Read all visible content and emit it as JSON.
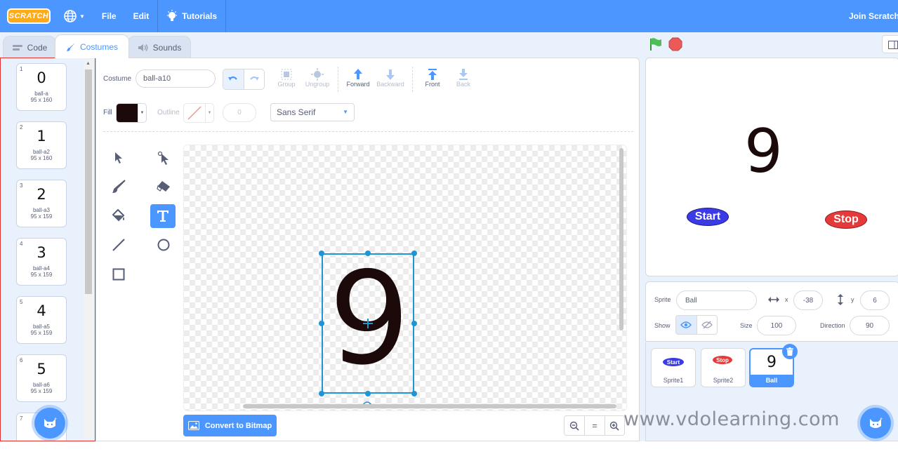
{
  "menubar": {
    "logo": "SCRATCH",
    "file": "File",
    "edit": "Edit",
    "tutorials": "Tutorials",
    "join": "Join Scratch"
  },
  "tabs": {
    "code": "Code",
    "costumes": "Costumes",
    "sounds": "Sounds"
  },
  "costumes": [
    {
      "num": "1",
      "glyph": "0",
      "name": "ball-a",
      "size": "95 x 160"
    },
    {
      "num": "2",
      "glyph": "1",
      "name": "ball-a2",
      "size": "95 x 160"
    },
    {
      "num": "3",
      "glyph": "2",
      "name": "ball-a3",
      "size": "95 x 159"
    },
    {
      "num": "4",
      "glyph": "3",
      "name": "ball-a4",
      "size": "95 x 159"
    },
    {
      "num": "5",
      "glyph": "4",
      "name": "ball-a5",
      "size": "95 x 159"
    },
    {
      "num": "6",
      "glyph": "5",
      "name": "ball-a6",
      "size": "95 x 159"
    },
    {
      "num": "7"
    }
  ],
  "editor": {
    "costume_label": "Costume",
    "costume_name": "ball-a10",
    "group": "Group",
    "ungroup": "Ungroup",
    "forward": "Forward",
    "backward": "Backward",
    "front": "Front",
    "back": "Back",
    "fill_label": "Fill",
    "fill_color": "#1c0a0a",
    "outline_label": "Outline",
    "outline_width": "0",
    "font": "Sans Serif",
    "canvas_text": "9",
    "convert_button": "Convert to Bitmap",
    "zoom_reset": "="
  },
  "stage": {
    "number": "9",
    "start": "Start",
    "stop": "Stop",
    "start_color": "#3a3ae6",
    "stop_color": "#e63a3a"
  },
  "sprite_info": {
    "sprite_label": "Sprite",
    "sprite_name": "Ball",
    "x_label": "x",
    "x_value": "-38",
    "y_label": "y",
    "y_value": "6",
    "show_label": "Show",
    "size_label": "Size",
    "size_value": "100",
    "direction_label": "Direction",
    "direction_value": "90"
  },
  "sprites": [
    {
      "name": "Sprite1",
      "thumb": "Start"
    },
    {
      "name": "Sprite2",
      "thumb": "Stop"
    },
    {
      "name": "Ball",
      "thumb": "9"
    }
  ],
  "watermark": "www.vdolearning.com",
  "accent": "#4c97ff"
}
